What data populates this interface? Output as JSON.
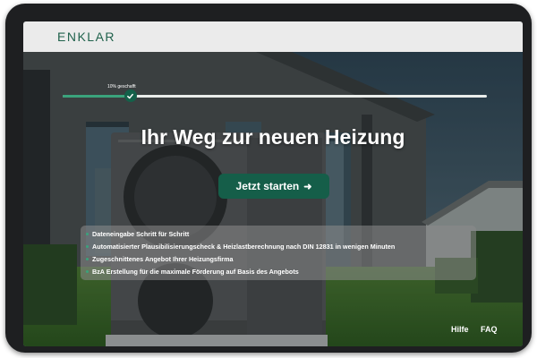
{
  "brand": {
    "name": "ENKLAR"
  },
  "progress": {
    "label": "10% geschafft",
    "value": 0.16
  },
  "hero": {
    "title": "Ihr Weg zur neuen Heizung"
  },
  "cta": {
    "label": "Jetzt starten",
    "icon": "arrow-right-icon"
  },
  "features": [
    "Dateneingabe Schritt für Schritt",
    "Automatisierter Plausibilisierungscheck & Heizlastberechnung nach DIN 12831 in wenigen Minuten",
    "Zugeschnittenes Angebot Ihrer Heizungsfirma",
    "BzA Erstellung für die maximale Förderung  auf Basis des Angebots"
  ],
  "footer": {
    "help_label": "Hilfe",
    "faq_label": "FAQ"
  },
  "colors": {
    "brand": "#20624c",
    "button": "#155e49",
    "accent": "#3aa37c",
    "header_bg": "#ebebeb"
  }
}
